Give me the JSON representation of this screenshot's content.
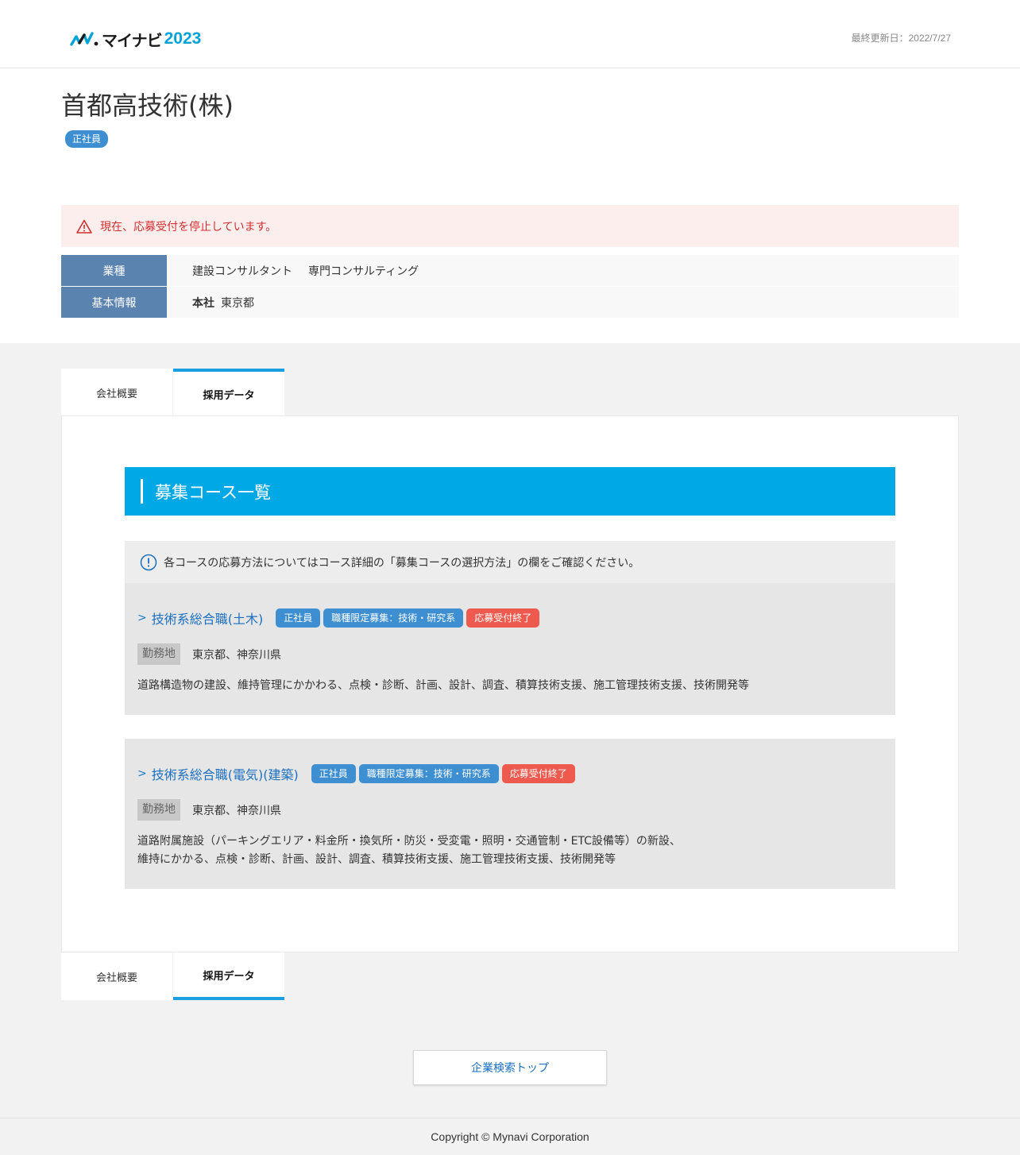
{
  "header": {
    "logo_text": "マイナビ",
    "logo_year": "2023",
    "updated": "最終更新日：2022/7/27"
  },
  "company": {
    "name": "首都高技術(株)",
    "badge": "正社員"
  },
  "alert": {
    "text": "現在、応募受付を停止しています。",
    "icon": "warning-icon",
    "color": "#d0302f"
  },
  "info": {
    "industry_label": "業種",
    "industry_values": [
      "建設コンサルタント",
      "専門コンサルティング"
    ],
    "basic_label": "基本情報",
    "hq_label": "本社",
    "hq_value": "東京都"
  },
  "tabs": {
    "overview": "会社概要",
    "recruit": "採用データ"
  },
  "section_title": "募集コース一覧",
  "notice": {
    "icon": "info-circle-icon",
    "text": "各コースの応募方法についてはコース詳細の「募集コースの選択方法」の欄をご確認ください。"
  },
  "courses": [
    {
      "title": "技術系総合職(土木)",
      "tags": [
        "正社員",
        "職種限定募集：技術・研究系",
        "応募受付終了"
      ],
      "location_label": "勤務地",
      "location": "東京都、神奈川県",
      "description": [
        "道路構造物の建設、維持管理にかかわる、点検・診断、計画、設計、調査、積算技術支援、施工管理技術支援、技術開発等"
      ]
    },
    {
      "title": "技術系総合職(電気)(建築)",
      "tags": [
        "正社員",
        "職種限定募集：技術・研究系",
        "応募受付終了"
      ],
      "location_label": "勤務地",
      "location": "東京都、神奈川県",
      "description": [
        "道路附属施設（パーキングエリア・料金所・換気所・防災・受変電・照明・交通管制・ETC設備等）の新設、",
        "維持にかかる、点検・診断、計画、設計、調査、積算技術支援、施工管理技術支援、技術開発等"
      ]
    }
  ],
  "search_top_button": "企業検索トップ",
  "footer": "Copyright © Mynavi Corporation",
  "colors": {
    "accent": "#00a8e6",
    "tab_active": "#1a9fe0",
    "label_bg": "#5b83b0",
    "tag_blue": "#3d8fd1",
    "tag_red": "#ee5a4e"
  }
}
